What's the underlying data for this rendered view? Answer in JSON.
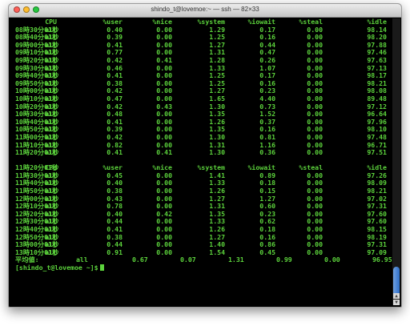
{
  "window": {
    "title": "shindo_t@lovemoe:~ — ssh — 82×33"
  },
  "header": [
    "",
    "CPU",
    "%user",
    "%nice",
    "%system",
    "%iowait",
    "%steal",
    "%idle"
  ],
  "block1": [
    [
      "08時30分01秒",
      "all",
      "0.40",
      "0.00",
      "1.29",
      "0.17",
      "0.00",
      "98.14"
    ],
    [
      "08時40分01秒",
      "all",
      "0.39",
      "0.00",
      "1.25",
      "0.16",
      "0.00",
      "98.20"
    ],
    [
      "09時00分01秒",
      "all",
      "0.41",
      "0.00",
      "1.27",
      "0.44",
      "0.00",
      "97.88"
    ],
    [
      "09時10分01秒",
      "all",
      "0.77",
      "0.00",
      "1.31",
      "0.47",
      "0.00",
      "97.46"
    ],
    [
      "09時20分01秒",
      "all",
      "0.42",
      "0.41",
      "1.28",
      "0.26",
      "0.00",
      "97.63"
    ],
    [
      "09時30分01秒",
      "all",
      "0.46",
      "0.00",
      "1.33",
      "1.07",
      "0.00",
      "97.13"
    ],
    [
      "09時40分01秒",
      "all",
      "0.41",
      "0.00",
      "1.25",
      "0.17",
      "0.00",
      "98.17"
    ],
    [
      "09時50分01秒",
      "all",
      "0.38",
      "0.00",
      "1.25",
      "0.16",
      "0.00",
      "98.21"
    ],
    [
      "10時00分01秒",
      "all",
      "0.42",
      "0.00",
      "1.27",
      "0.23",
      "0.00",
      "98.08"
    ],
    [
      "10時10分01秒",
      "all",
      "0.47",
      "0.00",
      "1.65",
      "4.40",
      "0.00",
      "89.48"
    ],
    [
      "10時20分01秒",
      "all",
      "0.42",
      "0.43",
      "1.30",
      "0.73",
      "0.00",
      "97.12"
    ],
    [
      "10時30分01秒",
      "all",
      "0.48",
      "0.00",
      "1.35",
      "1.52",
      "0.00",
      "96.64"
    ],
    [
      "10時40分01秒",
      "all",
      "0.41",
      "0.00",
      "1.26",
      "0.37",
      "0.00",
      "97.96"
    ],
    [
      "10時50分01秒",
      "all",
      "0.39",
      "0.00",
      "1.35",
      "0.16",
      "0.00",
      "98.10"
    ],
    [
      "11時00分01秒",
      "all",
      "0.42",
      "0.00",
      "1.30",
      "0.81",
      "0.00",
      "97.48"
    ],
    [
      "11時10分01秒",
      "all",
      "0.82",
      "0.00",
      "1.31",
      "1.16",
      "0.00",
      "96.71"
    ],
    [
      "11時20分01秒",
      "all",
      "0.41",
      "0.41",
      "1.30",
      "0.36",
      "0.00",
      "97.51"
    ]
  ],
  "header2": [
    "11時20分01秒",
    "CPU",
    "%user",
    "%nice",
    "%system",
    "%iowait",
    "%steal",
    "%idle"
  ],
  "block2": [
    [
      "11時30分01秒",
      "all",
      "0.45",
      "0.00",
      "1.41",
      "0.89",
      "0.00",
      "97.26"
    ],
    [
      "11時40分01秒",
      "all",
      "0.40",
      "0.00",
      "1.33",
      "0.18",
      "0.00",
      "98.09"
    ],
    [
      "11時50分01秒",
      "all",
      "0.38",
      "0.00",
      "1.26",
      "0.15",
      "0.00",
      "98.21"
    ],
    [
      "12時00分01秒",
      "all",
      "0.43",
      "0.00",
      "1.27",
      "1.27",
      "0.00",
      "97.02"
    ],
    [
      "12時10分01秒",
      "all",
      "0.78",
      "0.00",
      "1.31",
      "0.60",
      "0.00",
      "97.31"
    ],
    [
      "12時20分01秒",
      "all",
      "0.40",
      "0.42",
      "1.35",
      "0.23",
      "0.00",
      "97.60"
    ],
    [
      "12時30分01秒",
      "all",
      "0.44",
      "0.00",
      "1.33",
      "0.62",
      "0.00",
      "97.60"
    ],
    [
      "12時40分01秒",
      "all",
      "0.41",
      "0.00",
      "1.26",
      "0.18",
      "0.00",
      "98.15"
    ],
    [
      "12時50分01秒",
      "all",
      "0.38",
      "0.00",
      "1.27",
      "0.16",
      "0.00",
      "98.19"
    ],
    [
      "13時00分01秒",
      "all",
      "0.44",
      "0.00",
      "1.40",
      "0.86",
      "0.00",
      "97.31"
    ],
    [
      "13時10分01秒",
      "all",
      "0.91",
      "0.00",
      "1.54",
      "0.45",
      "0.00",
      "97.09"
    ]
  ],
  "average": [
    "平均値:",
    "all",
    "0.67",
    "0.07",
    "1.31",
    "0.99",
    "0.00",
    "96.95"
  ],
  "prompt": "[shindo_t@lovemoe ~]$"
}
